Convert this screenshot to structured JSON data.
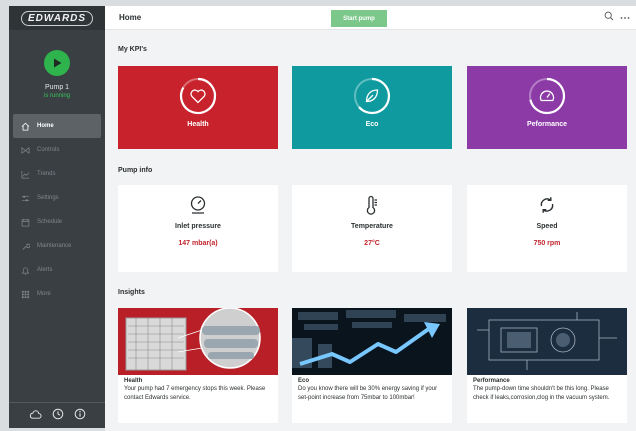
{
  "brand": {
    "name": "EDWARDS"
  },
  "pump": {
    "name": "Pump 1",
    "status": "is running"
  },
  "sidebar": {
    "items": [
      {
        "label": "Home",
        "icon": "home-icon",
        "active": true
      },
      {
        "label": "Controls",
        "icon": "controls-icon",
        "active": false
      },
      {
        "label": "Trends",
        "icon": "trends-icon",
        "active": false
      },
      {
        "label": "Settings",
        "icon": "settings-icon",
        "active": false
      },
      {
        "label": "Schedule",
        "icon": "calendar-icon",
        "active": false
      },
      {
        "label": "Maintenance",
        "icon": "wrench-icon",
        "active": false
      },
      {
        "label": "Alerts",
        "icon": "bell-icon",
        "active": false
      },
      {
        "label": "More",
        "icon": "grid-icon",
        "active": false
      }
    ],
    "footer_icons": [
      "cloud-icon",
      "clock-icon",
      "info-icon"
    ]
  },
  "header": {
    "title": "Home",
    "start_button": "Start pump",
    "search_icon": "search-icon",
    "more_icon": "more-icon"
  },
  "kpis": {
    "title": "My KPI's",
    "items": [
      {
        "label": "Health",
        "color": "#c8232c",
        "icon": "heart-icon"
      },
      {
        "label": "Eco",
        "color": "#0f9aa0",
        "icon": "leaf-icon"
      },
      {
        "label": "Peformance",
        "color": "#8c3aa6",
        "icon": "gauge-icon"
      }
    ]
  },
  "pump_info": {
    "title": "Pump info",
    "items": [
      {
        "label": "Inlet pressure",
        "value": "147 mbar(a)",
        "icon": "pressure-gauge-icon"
      },
      {
        "label": "Temperature",
        "value": "27°C",
        "icon": "thermometer-icon"
      },
      {
        "label": "Speed",
        "value": "750 rpm",
        "icon": "refresh-icon"
      }
    ]
  },
  "insights": {
    "title": "Insights",
    "items": [
      {
        "heading": "Health",
        "text": "Your pump had 7 emergency stops this week. Please contact Edwards service."
      },
      {
        "heading": "Eco",
        "text": "Do you know there will be 30% energy saving if your set-point increase from 75mbar to 100mbar!"
      },
      {
        "heading": "Performance",
        "text": "The pump-down time shouldn't be this long. Please check if leaks,corrosion,clog in the vacuum system."
      }
    ]
  },
  "colors": {
    "accent_red": "#c8232c",
    "start_green": "#7bc88a",
    "running_green": "#37c65a",
    "sidebar_bg": "#3a3f43"
  }
}
